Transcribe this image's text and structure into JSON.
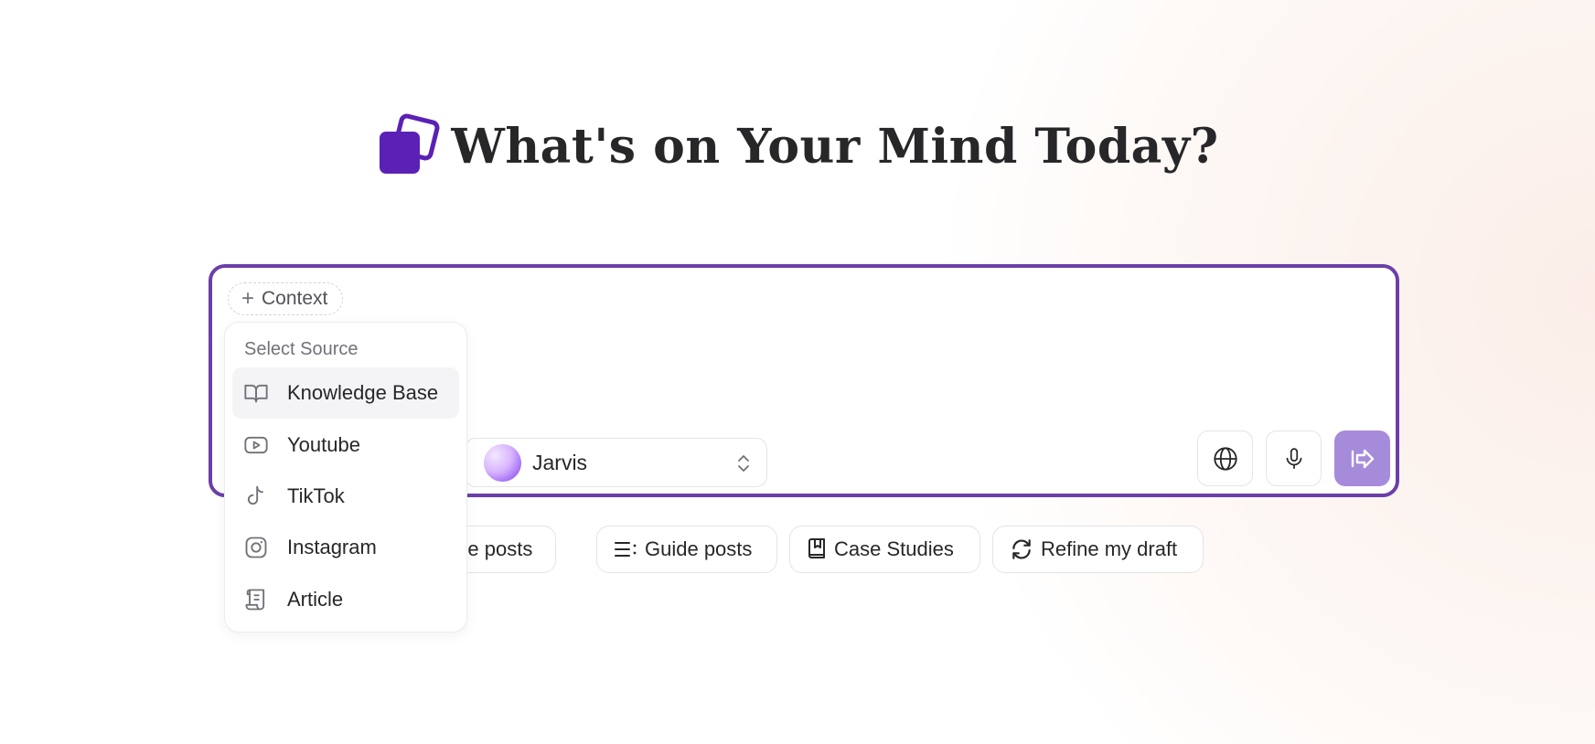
{
  "heading": {
    "title": "What's on Your Mind Today?"
  },
  "composer": {
    "context_label": "Context",
    "model_name": "Jarvis"
  },
  "dropdown": {
    "title": "Select Source",
    "items": [
      {
        "label": "Knowledge Base",
        "icon": "book-open-icon"
      },
      {
        "label": "Youtube",
        "icon": "youtube-icon"
      },
      {
        "label": "TikTok",
        "icon": "tiktok-icon"
      },
      {
        "label": "Instagram",
        "icon": "instagram-icon"
      },
      {
        "label": "Article",
        "icon": "scroll-icon"
      }
    ]
  },
  "chips": [
    {
      "label": "Value posts"
    },
    {
      "label": "Guide posts",
      "icon": "list-icon"
    },
    {
      "label": "Case Studies",
      "icon": "bookmark-book-icon"
    },
    {
      "label": "Refine my draft",
      "icon": "refresh-icon"
    }
  ],
  "colors": {
    "accent": "#6b3fa9",
    "logo": "#5b21b6",
    "send": "#a78bdb"
  }
}
